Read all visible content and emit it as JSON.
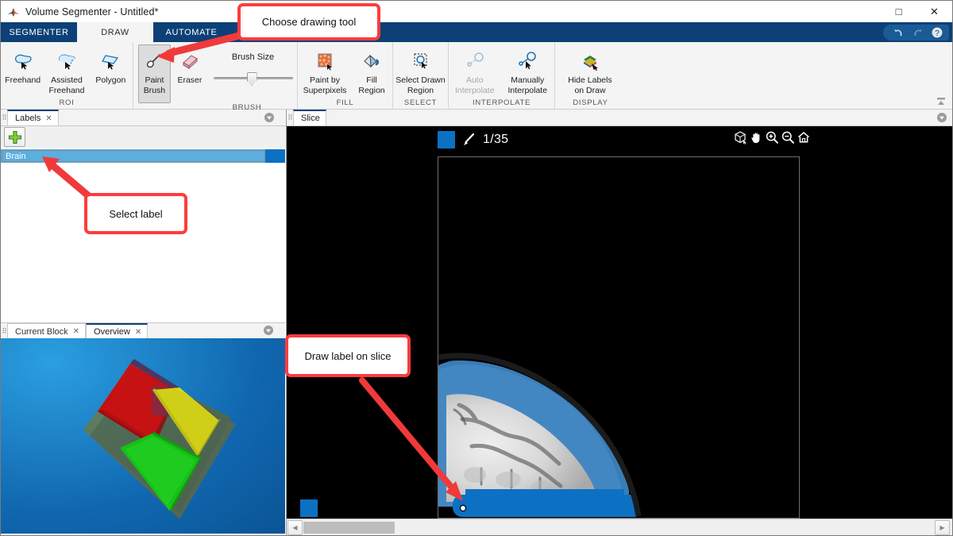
{
  "window": {
    "title": "Volume Segmenter - Untitled*",
    "app_icon": "matlab-logo-icon",
    "buttons": {
      "maximize": "□",
      "close": "✕"
    }
  },
  "ribbon": {
    "tabs": [
      {
        "label": "SEGMENTER",
        "active": false
      },
      {
        "label": "DRAW",
        "active": true
      },
      {
        "label": "AUTOMATE",
        "active": false
      }
    ],
    "quick_actions": [
      {
        "name": "undo-icon",
        "label": "Undo"
      },
      {
        "name": "redo-icon",
        "label": "Redo"
      },
      {
        "name": "help-icon",
        "label": "Help"
      }
    ],
    "groups": [
      {
        "title": "ROI",
        "buttons": [
          {
            "label": "Freehand",
            "icon": "freehand-icon",
            "state": "normal"
          },
          {
            "label": "Assisted\nFreehand",
            "icon": "assisted-freehand-icon",
            "state": "normal"
          },
          {
            "label": "Polygon",
            "icon": "polygon-icon",
            "state": "normal"
          }
        ]
      },
      {
        "title": "BRUSH",
        "buttons": [
          {
            "label": "Paint\nBrush",
            "icon": "paint-brush-icon",
            "state": "selected"
          },
          {
            "label": "Eraser",
            "icon": "eraser-icon",
            "state": "normal"
          }
        ],
        "slider": {
          "label": "Brush Size",
          "value_percent": 44
        }
      },
      {
        "title": "FILL",
        "buttons": [
          {
            "label": "Paint by\nSuperpixels",
            "icon": "superpixels-icon",
            "state": "normal"
          },
          {
            "label": "Fill\nRegion",
            "icon": "fill-region-icon",
            "state": "normal"
          }
        ]
      },
      {
        "title": "SELECT",
        "buttons": [
          {
            "label": "Select Drawn\nRegion",
            "icon": "select-drawn-region-icon",
            "state": "normal"
          }
        ]
      },
      {
        "title": "INTERPOLATE",
        "buttons": [
          {
            "label": "Auto\nInterpolate",
            "icon": "auto-interpolate-icon",
            "state": "disabled"
          },
          {
            "label": "Manually\nInterpolate",
            "icon": "manually-interpolate-icon",
            "state": "normal"
          }
        ]
      },
      {
        "title": "DISPLAY",
        "buttons": [
          {
            "label": "Hide Labels\non Draw",
            "icon": "hide-labels-icon",
            "state": "normal"
          }
        ]
      }
    ],
    "collapse_icon": "collapse-ribbon-icon"
  },
  "labels_panel": {
    "tab": {
      "label": "Labels",
      "close": "✕"
    },
    "menu_icon": "panel-options-icon",
    "add_button_icon": "add-label-icon",
    "rows": [
      {
        "name": "Brain",
        "color": "#0c71c3",
        "selected": true
      }
    ]
  },
  "bottom_panel": {
    "tabs": [
      {
        "label": "Current Block",
        "close": "✕",
        "active": false
      },
      {
        "label": "Overview",
        "close": "✕",
        "active": true
      }
    ],
    "menu_icon": "panel-options-icon",
    "volume_colors": [
      "#cc1111",
      "#d8d81a",
      "#18c818",
      "#6b6b33",
      "#5a3a6e"
    ],
    "background_color": "#1a86cd"
  },
  "slice_panel": {
    "tab": {
      "label": "Slice"
    },
    "menu_icon": "panel-options-icon",
    "slice_counter": "1/35",
    "pen_icon": "pen-icon",
    "label_chip_color": "#0c71c3",
    "view_icons": [
      {
        "name": "rotate-3d-icon",
        "label": "Rotate 3D"
      },
      {
        "name": "pan-icon",
        "label": "Pan"
      },
      {
        "name": "zoom-in-icon",
        "label": "Zoom In"
      },
      {
        "name": "zoom-out-icon",
        "label": "Zoom Out"
      },
      {
        "name": "home-icon",
        "label": "Restore View"
      }
    ],
    "scrollbar": {
      "left_arrow": "◀",
      "right_arrow": "▶"
    }
  },
  "annotations": [
    {
      "id": "choose-drawing-tool",
      "text": "Choose drawing tool"
    },
    {
      "id": "select-label",
      "text": "Select label"
    },
    {
      "id": "draw-label-on-slice",
      "text": "Draw label on slice"
    }
  ],
  "colors": {
    "ribbon_blue": "#0c4076",
    "annotation_red": "#fc3d3d",
    "label_blue": "#0c71c3",
    "selection_blue": "#5aaee0"
  }
}
